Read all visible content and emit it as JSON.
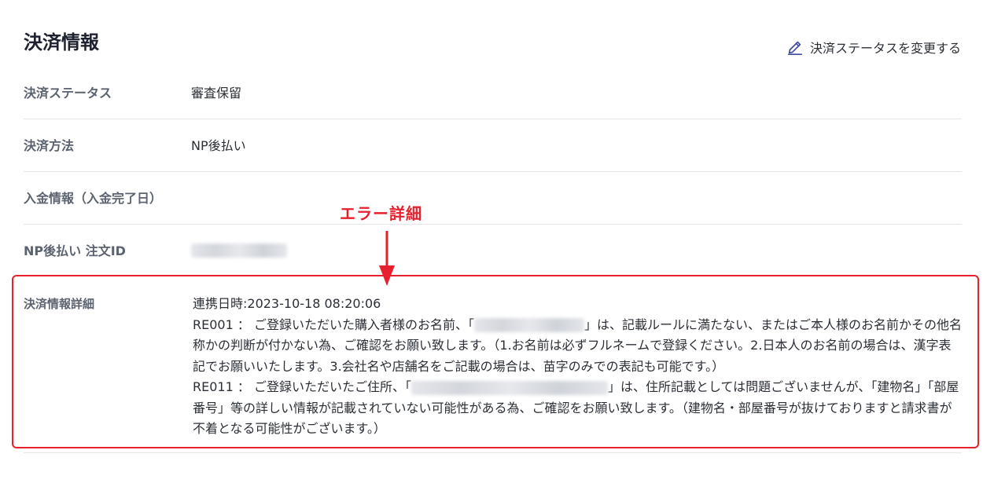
{
  "page": {
    "title": "決済情報"
  },
  "actions": {
    "edit_status": "決済ステータスを変更する"
  },
  "rows": [
    {
      "label": "決済ステータス",
      "value": "審査保留"
    },
    {
      "label": "決済方法",
      "value": "NP後払い"
    },
    {
      "label": "入金情報（入金完了日）",
      "value": ""
    },
    {
      "label": "NP後払い 注文ID",
      "value": ""
    }
  ],
  "detail": {
    "label": "決済情報詳細",
    "linked_at": "連携日時:2023-10-18 08:20:06",
    "re001_prefix": "RE001 ： ご登録いただいた購入者様のお名前、「",
    "re001_suffix": "」は、記載ルールに満たない、またはご本人様のお名前かその他名称かの判断が付かない為、ご確認をお願い致します。（1.お名前は必ずフルネームで登録ください。2.日本人のお名前の場合は、漢字表記でお願いいたします。3.会社名や店舗名をご記載の場合は、苗字のみでの表記も可能です。）",
    "re011_prefix": "RE011 ： ご登録いただいたご住所、「",
    "re011_suffix": "」は、住所記載としては問題ございませんが、「建物名」「部屋番号」等の詳しい情報が記載されていない可能性がある為、ご確認をお願い致します。（建物名・部屋番号が抜けておりますと請求書が不着となる可能性がございます。）"
  },
  "annotation": {
    "text": "エラー詳細",
    "color": "#e6202c"
  }
}
